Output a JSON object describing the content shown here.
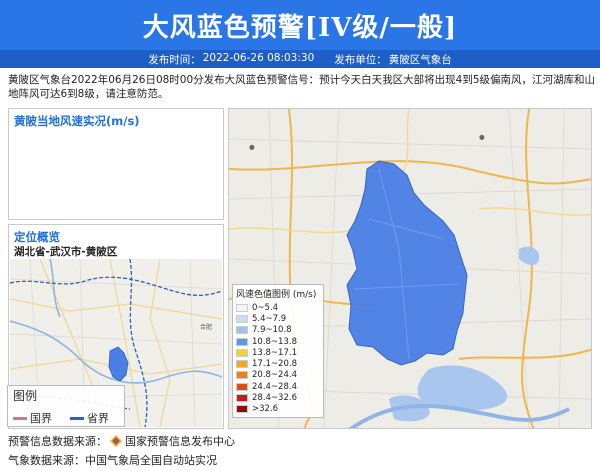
{
  "header": {
    "title": "大风蓝色预警[IV级/一般]"
  },
  "subbar": {
    "time_label": "发布时间：",
    "time_value": "2022-06-26 08:03:30",
    "unit_label": "发布单位：",
    "unit_value": "黄陂区气象台"
  },
  "description": "黄陂区气象台2022年06月26日08时00分发布大风蓝色预警信号：预计今天白天我区大部将出现4到5级偏南风，江河湖库和山地阵风可达6到8级，请注意防范。",
  "wind_panel": {
    "title": "黄陂当地风速实况(m/s)"
  },
  "location_panel": {
    "title": "定位概览",
    "region": "湖北省-武汉市-黄陂区",
    "legend_title": "图例",
    "legend_items": [
      {
        "label": "国界",
        "color": "#c97a8a"
      },
      {
        "label": "省界",
        "color": "#2b5fc4"
      }
    ]
  },
  "map": {
    "district_fill": "#4a7fe6",
    "scale_title": "风速色值图例 (m/s)",
    "scale": [
      {
        "label": "0~5.4",
        "color": "#f6f6f6"
      },
      {
        "label": "5.4~7.9",
        "color": "#c9dcf2"
      },
      {
        "label": "7.9~10.8",
        "color": "#9ec2ee"
      },
      {
        "label": "10.8~13.8",
        "color": "#5e95ea"
      },
      {
        "label": "13.8~17.1",
        "color": "#f2d236"
      },
      {
        "label": "17.1~20.8",
        "color": "#f0a82a"
      },
      {
        "label": "20.8~24.4",
        "color": "#ee7d20"
      },
      {
        "label": "24.4~28.4",
        "color": "#e04a1c"
      },
      {
        "label": "28.4~32.6",
        "color": "#c0201a"
      },
      {
        "label": ">32.6",
        "color": "#8e0f10"
      }
    ]
  },
  "footer": {
    "warning_source_label": "预警信息数据来源：",
    "warning_source_value": "国家预警信息发布中心",
    "weather_source_label": "气象数据来源：",
    "weather_source_value": "中国气象局全国自动站实况"
  }
}
